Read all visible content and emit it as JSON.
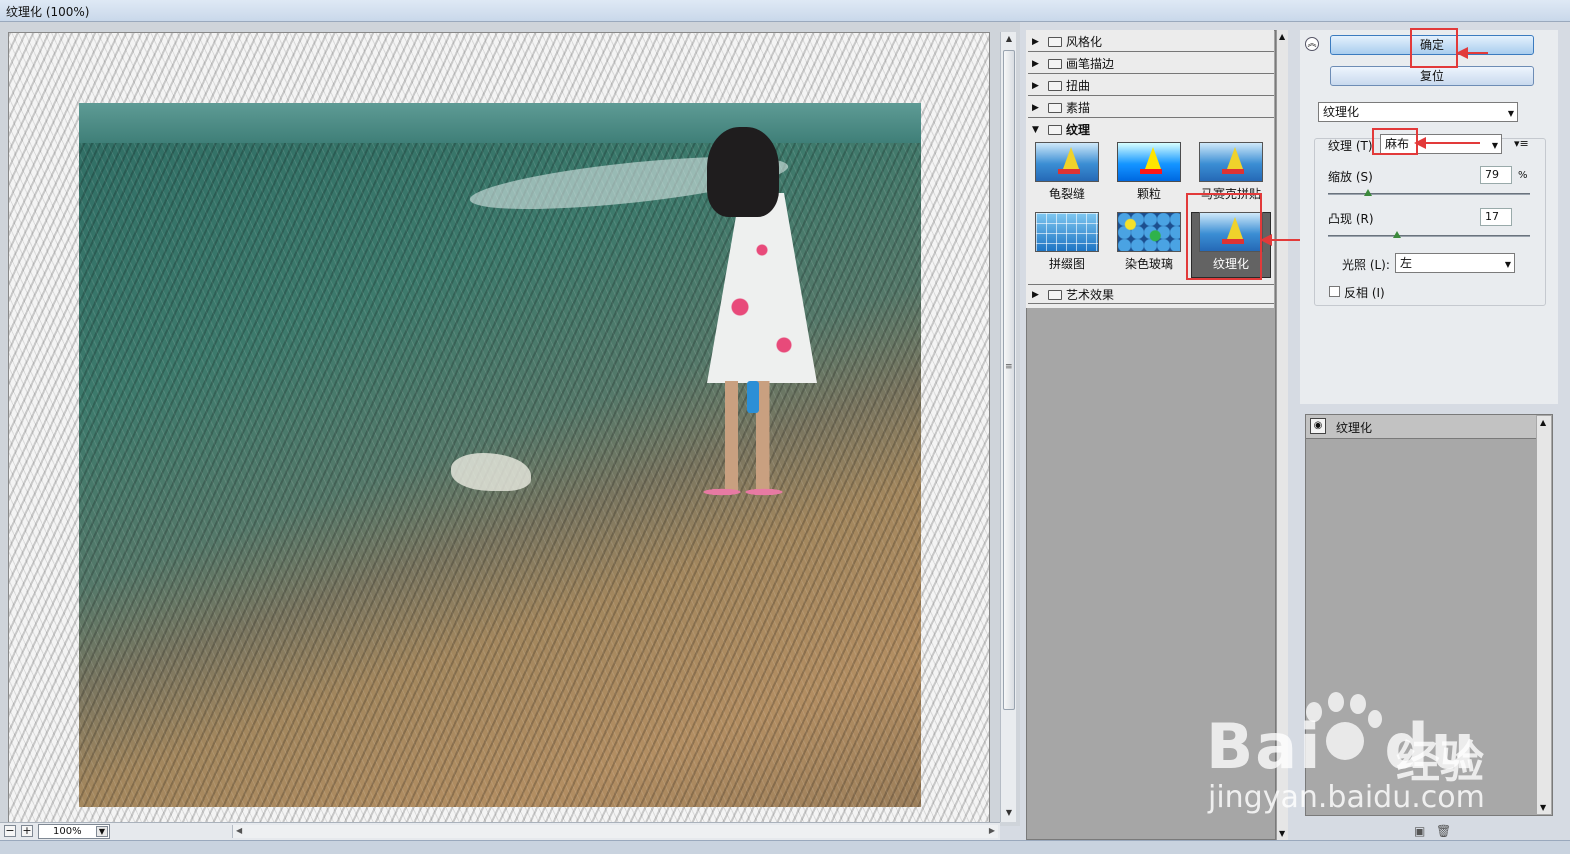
{
  "window": {
    "title": "纹理化 (100%)"
  },
  "preview": {
    "zoom": "100%",
    "zoom_out": "−",
    "zoom_in": "+"
  },
  "gallery": {
    "categories": [
      {
        "label": "风格化",
        "expanded": false
      },
      {
        "label": "画笔描边",
        "expanded": false
      },
      {
        "label": "扭曲",
        "expanded": false
      },
      {
        "label": "素描",
        "expanded": false
      },
      {
        "label": "纹理",
        "expanded": true
      },
      {
        "label": "艺术效果",
        "expanded": false
      }
    ],
    "texture_filters": [
      {
        "label": "龟裂缝"
      },
      {
        "label": "颗粒"
      },
      {
        "label": "马赛克拼贴"
      },
      {
        "label": "拼缀图"
      },
      {
        "label": "染色玻璃"
      },
      {
        "label": "纹理化",
        "selected": true
      }
    ]
  },
  "controls": {
    "ok_label": "确定",
    "reset_label": "复位",
    "filter_select": "纹理化",
    "texture_label": "纹理 (T)",
    "texture_value": "麻布",
    "scaling_label": "缩放 (S)",
    "scaling_value": "79",
    "scaling_unit": "%",
    "scaling_fraction": 0.2,
    "relief_label": "凸现 (R)",
    "relief_value": "17",
    "relief_fraction": 0.34,
    "light_label": "光照 (L):",
    "light_value": "左",
    "invert_label": "反相 (I)",
    "invert_checked": false
  },
  "layers": {
    "items": [
      {
        "label": "纹理化"
      }
    ]
  },
  "watermark": {
    "brand": "Bai",
    "brand2": "du",
    "product": "经验",
    "url": "jingyan.baidu.com"
  },
  "colors": {
    "highlight_red": "#e23a3a",
    "selection_gray": "#636363",
    "panel_gray": "#a6a6a6"
  },
  "icons": {
    "collapse": "double-chevron-up-icon",
    "texture_menu": "menu-lines-icon",
    "new_layer": "new-layer-icon",
    "delete_layer": "trash-icon",
    "eye": "eye-icon"
  }
}
